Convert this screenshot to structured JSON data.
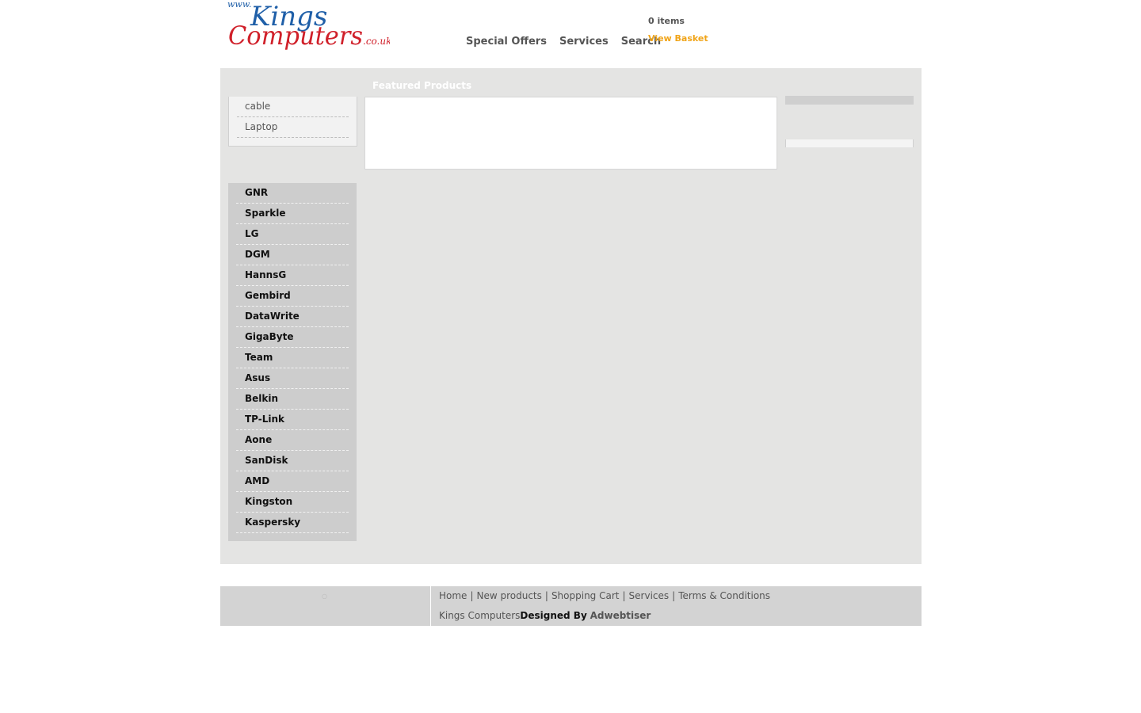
{
  "header": {
    "logo": {
      "prefix": "www.",
      "line1": "Kings",
      "line2": "Computers",
      "suffix": ".co.uk"
    },
    "nav": [
      {
        "label": "Special Offers"
      },
      {
        "label": "Services"
      },
      {
        "label": "Search"
      }
    ],
    "cart": {
      "items_text": "0 items",
      "view_basket_label": "View Basket"
    }
  },
  "categories": [
    {
      "label": "cable"
    },
    {
      "label": "Laptop"
    }
  ],
  "featured": {
    "title": "Featured Products"
  },
  "brands": [
    {
      "label": "GNR"
    },
    {
      "label": "Sparkle"
    },
    {
      "label": "LG"
    },
    {
      "label": "DGM"
    },
    {
      "label": "HannsG"
    },
    {
      "label": "Gembird"
    },
    {
      "label": "DataWrite"
    },
    {
      "label": "GigaByte"
    },
    {
      "label": "Team"
    },
    {
      "label": "Asus"
    },
    {
      "label": "Belkin"
    },
    {
      "label": "TP-Link"
    },
    {
      "label": "Aone"
    },
    {
      "label": "SanDisk"
    },
    {
      "label": "AMD"
    },
    {
      "label": "Kingston"
    },
    {
      "label": "Kaspersky"
    }
  ],
  "footer": {
    "links": [
      {
        "label": "Home"
      },
      {
        "label": "New products"
      },
      {
        "label": "Shopping Cart"
      },
      {
        "label": "Services"
      },
      {
        "label": "Terms & Conditions"
      }
    ],
    "separator": "|",
    "company": "Kings Computers",
    "designed_by": "Designed By",
    "designer": "Adwebtiser"
  },
  "colors": {
    "logo_blue": "#1f5fa8",
    "logo_red": "#d0202a",
    "basket_orange": "#f0a418",
    "main_bg": "#e4e4e3",
    "brand_bg": "#cdcdcd",
    "footer_bg": "#d3d3d3"
  }
}
